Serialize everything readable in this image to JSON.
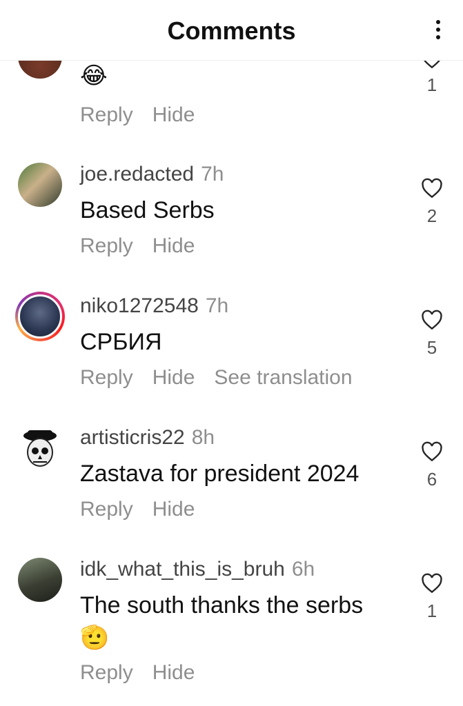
{
  "header": {
    "title": "Comments",
    "menu_icon": "more-vertical-icon"
  },
  "comments": [
    {
      "username": "",
      "time": "",
      "text": "😂",
      "like_count": "1",
      "actions": {
        "reply": "Reply",
        "hide": "Hide"
      }
    },
    {
      "username": "joe.redacted",
      "time": "7h",
      "text": "Based Serbs",
      "like_count": "2",
      "actions": {
        "reply": "Reply",
        "hide": "Hide"
      }
    },
    {
      "username": "niko1272548",
      "time": "7h",
      "text": "СРБИЯ",
      "like_count": "5",
      "actions": {
        "reply": "Reply",
        "hide": "Hide",
        "translate": "See translation"
      }
    },
    {
      "username": "artisticris22",
      "time": "8h",
      "text": "Zastava for president 2024",
      "like_count": "6",
      "actions": {
        "reply": "Reply",
        "hide": "Hide"
      }
    },
    {
      "username": "idk_what_this_is_bruh",
      "time": "6h",
      "text": "The south thanks the serbs",
      "text_line2": "🫡",
      "like_count": "1",
      "actions": {
        "reply": "Reply",
        "hide": "Hide"
      }
    }
  ],
  "icons": {
    "like": "heart-outline-icon"
  },
  "colors": {
    "primary_text": "#111111",
    "secondary_text": "#8e8e8e",
    "story_ring": "#e1306c"
  }
}
